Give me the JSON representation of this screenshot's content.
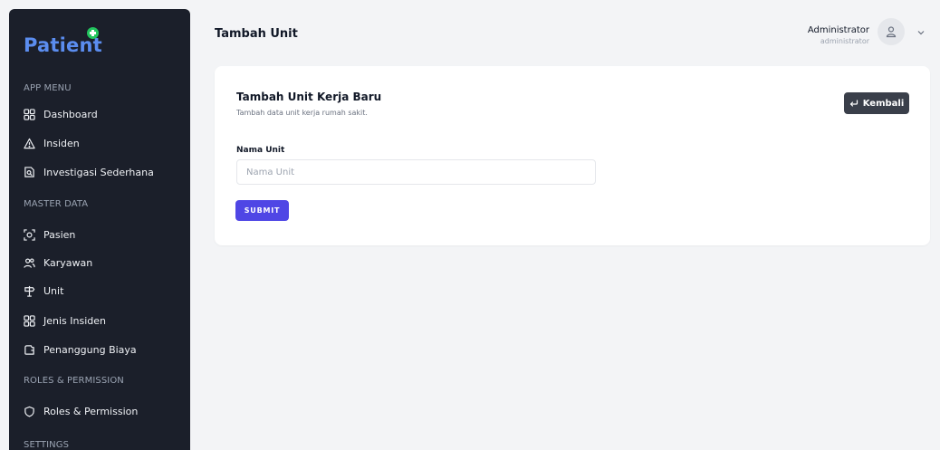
{
  "brand": {
    "name": "Patient",
    "badge_icon": "plus-circle-icon",
    "color": "#5b8def",
    "badge_color": "#22c55e"
  },
  "sidebar": {
    "sections": [
      {
        "label": "APP MENU"
      },
      {
        "label": "MASTER DATA"
      },
      {
        "label": "ROLES & PERMISSION"
      },
      {
        "label": "SETTINGS"
      }
    ],
    "items": [
      {
        "label": "Dashboard",
        "icon": "grid-icon"
      },
      {
        "label": "Insiden",
        "icon": "warning-triangle-icon"
      },
      {
        "label": "Investigasi Sederhana",
        "icon": "document-search-icon"
      },
      {
        "label": "Pasien",
        "icon": "face-scan-icon"
      },
      {
        "label": "Karyawan",
        "icon": "users-icon"
      },
      {
        "label": "Unit",
        "icon": "signpost-icon"
      },
      {
        "label": "Jenis Insiden",
        "icon": "grid-icon"
      },
      {
        "label": "Penanggung Biaya",
        "icon": "wallet-icon"
      },
      {
        "label": "Roles & Permission",
        "icon": "shield-icon"
      }
    ]
  },
  "header": {
    "title": "Tambah Unit",
    "user_name": "Administrator",
    "user_role": "administrator"
  },
  "card": {
    "title": "Tambah Unit Kerja Baru",
    "subtitle": "Tambah data unit kerja rumah sakit.",
    "back_label": "Kembali",
    "field_label": "Nama Unit",
    "field_placeholder": "Nama Unit",
    "field_value": "",
    "submit_label": "SUBMIT"
  },
  "colors": {
    "sidebar_bg": "#1b1f2a",
    "accent": "#4f46e5",
    "back_button_bg": "#3a3f4a"
  }
}
